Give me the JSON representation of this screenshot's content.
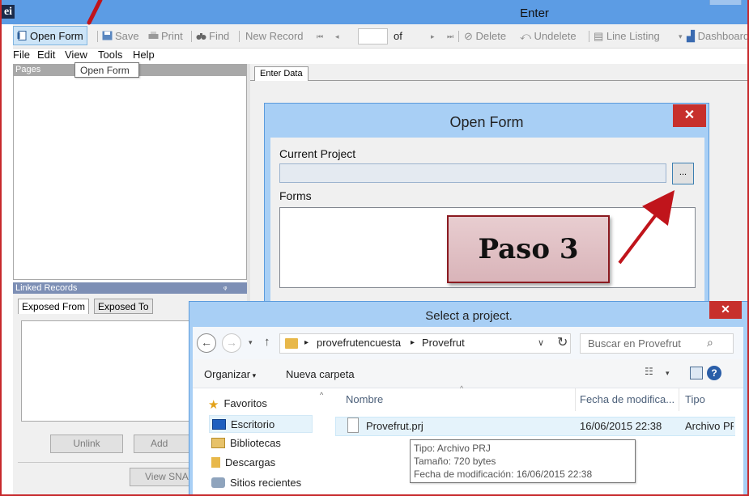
{
  "app": {
    "logo_text": "ei",
    "title": "Enter"
  },
  "toolbar": {
    "open_form": "Open Form",
    "save": "Save",
    "print": "Print",
    "find": "Find",
    "new_record": "New Record",
    "record_of": "of",
    "delete": "Delete",
    "undelete": "Undelete",
    "line_listing": "Line Listing",
    "dashboard": "Dashboard"
  },
  "menu": {
    "items": [
      "File",
      "Edit",
      "View",
      "Tools",
      "Help"
    ]
  },
  "tooltip_open_form": "Open Form",
  "pages_panel": {
    "title": "Pages"
  },
  "linked_records": {
    "title": "Linked Records",
    "tabs": [
      "Exposed From",
      "Exposed To"
    ],
    "unlink": "Unlink",
    "add_exposed": "Add Expo",
    "view_sna": "View SNA"
  },
  "enter_data_tab": "Enter Data",
  "open_form_dialog": {
    "title": "Open Form",
    "current_project_label": "Current Project",
    "current_project_value": "",
    "browse_button": "...",
    "forms_label": "Forms"
  },
  "annotation": {
    "text": "Paso 3"
  },
  "select_project_dialog": {
    "title": "Select a project.",
    "breadcrumb": [
      "provefrutencuesta",
      "Provefrut"
    ],
    "search_placeholder": "Buscar en Provefrut",
    "organize": "Organizar",
    "new_folder": "Nueva carpeta",
    "nav_items": [
      "Favoritos",
      "Escritorio",
      "Bibliotecas",
      "Descargas",
      "Sitios recientes"
    ],
    "columns": [
      "Nombre",
      "Fecha de modifica...",
      "Tipo"
    ],
    "files": [
      {
        "name": "Provefrut.prj",
        "modified": "16/06/2015 22:38",
        "type": "Archivo PR"
      }
    ],
    "file_tooltip": [
      "Tipo: Archivo PRJ",
      "Tamaño: 720 bytes",
      "Fecha de modificación: 16/06/2015 22:38"
    ]
  },
  "colors": {
    "titlebar": "#5c9ce4",
    "dialog_frame": "#a8cff5",
    "close_button": "#c7302c",
    "annotation_arrow": "#c0141b",
    "banner_border": "#8b1a20"
  }
}
